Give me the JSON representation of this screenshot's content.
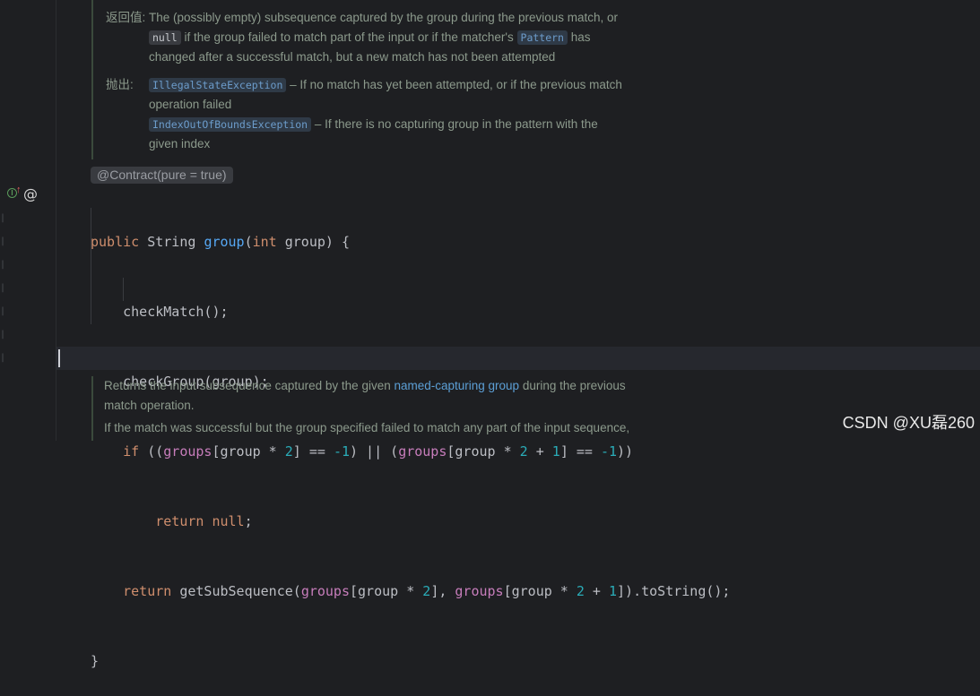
{
  "doc_top": {
    "returns_label": "返回值:",
    "returns_line1": "The (possibly empty) subsequence captured by the group during the previous match, or",
    "null_chip": "null",
    "returns_line2_mid": "if the group failed to match part of the input or if the matcher's",
    "pattern_chip": "Pattern",
    "returns_line2_end": "has",
    "returns_line3": "changed after a successful match, but a new match has not been attempted",
    "throws_label": "抛出:",
    "ex1_chip": "IllegalStateException",
    "ex1_text": "– If no match has yet been attempted, or if the previous match",
    "ex1_text2": "operation failed",
    "ex2_chip": "IndexOutOfBoundsException",
    "ex2_text": "– If there is no capturing group in the pattern with the",
    "ex2_text2": "given index"
  },
  "inlay": "@Contract(pure = true)",
  "code": {
    "l1_public": "public",
    "l1_string": " String ",
    "l1_group": "group",
    "l1_paren_open": "(",
    "l1_int": "int",
    "l1_rest": " group) {",
    "l2": "    checkMatch();",
    "l3": "    checkGroup(group);",
    "l4_indent": "    ",
    "l4_if": "if",
    "l4_a": " ((",
    "l4_groups1": "groups",
    "l4_b": "[group * ",
    "l4_num2a": "2",
    "l4_c": "] == ",
    "l4_neg1a": "-1",
    "l4_d": ") || (",
    "l4_groups2": "groups",
    "l4_e": "[group * ",
    "l4_num2b": "2",
    "l4_f": " + ",
    "l4_num1": "1",
    "l4_g": "] == ",
    "l4_neg1b": "-1",
    "l4_h": "))",
    "l5_indent": "        ",
    "l5_return": "return",
    "l5_sp": " ",
    "l5_null": "null",
    "l5_semi": ";",
    "l6_indent": "    ",
    "l6_return": "return",
    "l6_a": " getSubSequence(",
    "l6_groups1": "groups",
    "l6_b": "[group * ",
    "l6_num2a": "2",
    "l6_c": "], ",
    "l6_groups2": "groups",
    "l6_d": "[group * ",
    "l6_num2b": "2",
    "l6_e": " + ",
    "l6_num1": "1",
    "l6_f": "]).toString();",
    "l7": "}"
  },
  "doc_bottom": {
    "p1_a": "Returns the input subsequence captured by the given ",
    "p1_link": "named-capturing group",
    "p1_b": " during the previous",
    "p1_line2": "match operation.",
    "p2": "If the match was successful but the group specified failed to match any part of the input sequence,"
  },
  "watermark": "CSDN @XU磊260"
}
